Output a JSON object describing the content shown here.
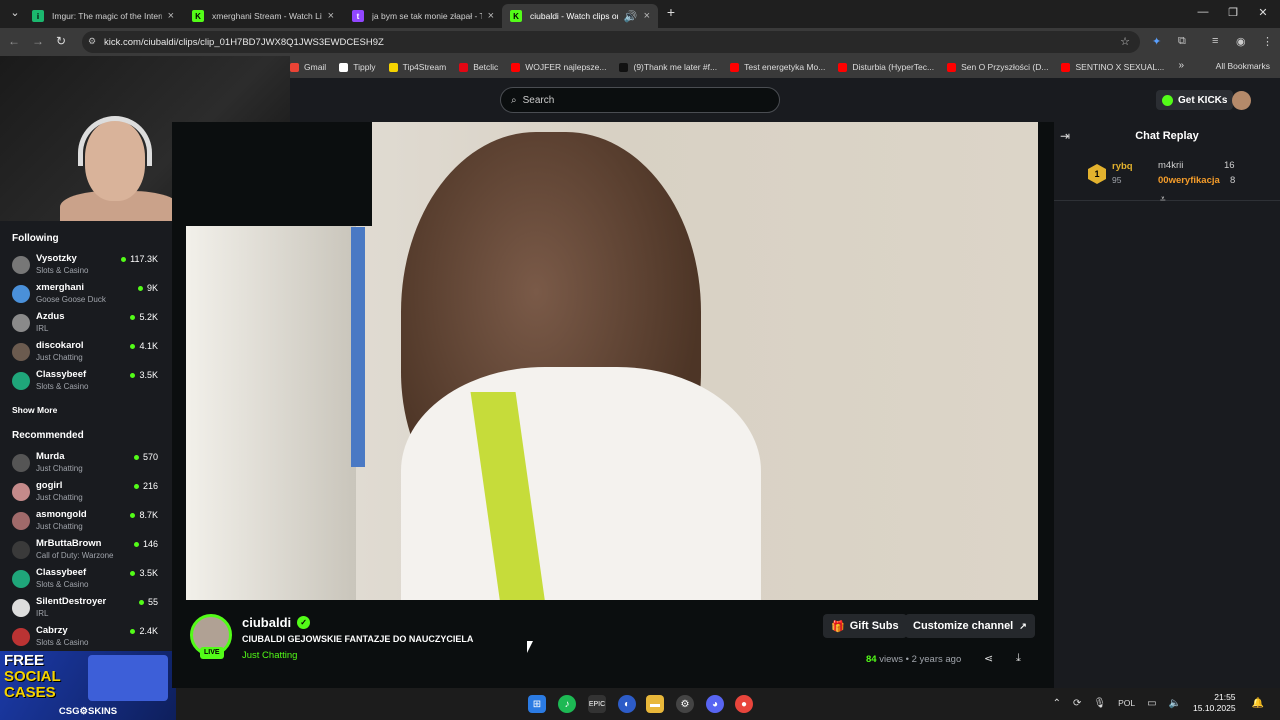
{
  "browser": {
    "tabs": [
      {
        "title": "Imgur: The magic of the Interne",
        "favicon_color": "#1bb76e",
        "favicon_glyph": "i",
        "active": false
      },
      {
        "title": "xmerghani Stream - Watch Live",
        "favicon_color": "#53fc18",
        "favicon_glyph": "K",
        "active": false
      },
      {
        "title": "ja bym se tak monie złapał - Tw",
        "favicon_color": "#9146ff",
        "favicon_glyph": "t",
        "active": false
      },
      {
        "title": "ciubaldi - Watch clips on Ki",
        "favicon_color": "#53fc18",
        "favicon_glyph": "K",
        "active": true
      }
    ],
    "new_tab_glyph": "+",
    "url": "kick.com/ciubaldi/clips/clip_01H7BD7JWX8Q1JWS3EWDCESH9Z",
    "bookmarks": [
      {
        "label": "Gmail",
        "color": "#ea4335"
      },
      {
        "label": "Tipply",
        "color": "#ffffff"
      },
      {
        "label": "Tip4Stream",
        "color": "#f5d300"
      },
      {
        "label": "Betclic",
        "color": "#e30613"
      },
      {
        "label": "WOJFER najlepsze...",
        "color": "#ff0000"
      },
      {
        "label": "(9)Thank me later #f...",
        "color": "#111111"
      },
      {
        "label": "Test energetyka Mo...",
        "color": "#ff0000"
      },
      {
        "label": "Disturbia (HyperTec...",
        "color": "#ff0000"
      },
      {
        "label": "Sen O Przyszłości (D...",
        "color": "#ff0000"
      },
      {
        "label": "SENTINO X SEXUAL...",
        "color": "#ff0000"
      }
    ],
    "all_bookmarks": "All Bookmarks"
  },
  "header": {
    "search_placeholder": "Search",
    "get_kicks": "Get KICKs"
  },
  "sidebar": {
    "following_title": "Following",
    "following": [
      {
        "name": "Vysotzky",
        "category": "Slots & Casino",
        "viewers": "117.3K",
        "avatar_color": "#777777"
      },
      {
        "name": "xmerghani",
        "category": "Goose Goose Duck",
        "viewers": "9K",
        "avatar_color": "#4a90d9"
      },
      {
        "name": "Azdus",
        "category": "IRL",
        "viewers": "5.2K",
        "avatar_color": "#8a8a8a"
      },
      {
        "name": "discokarol",
        "category": "Just Chatting",
        "viewers": "4.1K",
        "avatar_color": "#6b5b4f"
      },
      {
        "name": "Classybeef",
        "category": "Slots & Casino",
        "viewers": "3.5K",
        "avatar_color": "#1fa67a"
      }
    ],
    "show_more": "Show More",
    "recommended_title": "Recommended",
    "recommended": [
      {
        "name": "Murda",
        "category": "Just Chatting",
        "viewers": "570",
        "avatar_color": "#555555"
      },
      {
        "name": "gogirl",
        "category": "Just Chatting",
        "viewers": "216",
        "avatar_color": "#c48a8a"
      },
      {
        "name": "asmongold",
        "category": "Just Chatting",
        "viewers": "8.7K",
        "avatar_color": "#a06a6a"
      },
      {
        "name": "MrButtaBrown",
        "category": "Call of Duty: Warzone",
        "viewers": "146",
        "avatar_color": "#3a3a3a"
      },
      {
        "name": "Classybeef",
        "category": "Slots & Casino",
        "viewers": "3.5K",
        "avatar_color": "#1fa67a"
      },
      {
        "name": "SilentDestroyer",
        "category": "IRL",
        "viewers": "55",
        "avatar_color": "#dddddd"
      },
      {
        "name": "Cabrzy",
        "category": "Slots & Casino",
        "viewers": "2.4K",
        "avatar_color": "#bb3333"
      }
    ]
  },
  "ad": {
    "line1": "FREE",
    "line2": "SOCIAL",
    "line3": "CASES",
    "brand": "CSG⚙SKINS"
  },
  "clip": {
    "channel_name": "ciubaldi",
    "live_badge": "LIVE",
    "title": "CIUBALDI GEJOWSKIE FANTAZJE DO NAUCZYCIELA",
    "category": "Just Chatting",
    "gift_subs": "Gift Subs",
    "customize_channel": "Customize channel",
    "views_count": "84",
    "views_label": " views",
    "age": " • 2 years ago"
  },
  "chat": {
    "title": "Chat Replay",
    "leaderboard": {
      "rank": "1",
      "first_user": "rybq",
      "first_count": "95",
      "second_user": "m4krii",
      "second_count": "16",
      "third_user": "00weryfikacja",
      "third_count": "8"
    }
  },
  "taskbar": {
    "language": "POL",
    "time": "21:55",
    "date": "15.10.2025"
  },
  "colors": {
    "kick_green": "#53fc18",
    "background": "#0b0e0f",
    "panel": "#191b1f"
  }
}
